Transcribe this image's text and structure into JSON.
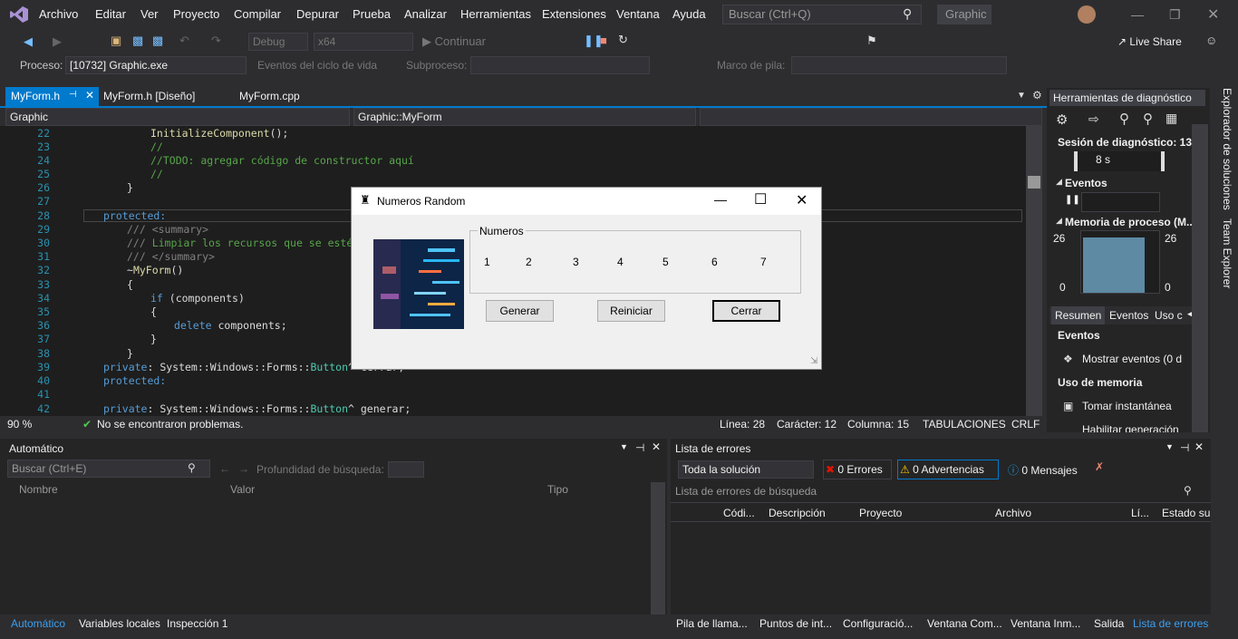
{
  "menu": [
    "Archivo",
    "Editar",
    "Ver",
    "Proyecto",
    "Compilar",
    "Depurar",
    "Prueba",
    "Analizar",
    "Herramientas",
    "Extensiones",
    "Ventana",
    "Ayuda"
  ],
  "search_placeholder": "Buscar (Ctrl+Q)",
  "app_name": "Graphic",
  "toolbar": {
    "config": "Debug",
    "platform": "x64",
    "continue": "Continuar",
    "live_share": "Live Share"
  },
  "procbar": {
    "process_label": "Proceso:",
    "process_value": "[10732] Graphic.exe",
    "lifecycle": "Eventos del ciclo de vida",
    "subprocess": "Subproceso:",
    "stack": "Marco de pila:"
  },
  "tabs": [
    {
      "label": "MyForm.h",
      "active": true
    },
    {
      "label": "MyForm.h [Diseño]",
      "active": false
    },
    {
      "label": "MyForm.cpp",
      "active": false
    }
  ],
  "nav": {
    "project": "Graphic",
    "scope": "Graphic::MyForm"
  },
  "editor": {
    "lines": [
      "22",
      "23",
      "24",
      "25",
      "26",
      "27",
      "28",
      "29",
      "30",
      "31",
      "32",
      "33",
      "34",
      "35",
      "36",
      "37",
      "38",
      "39",
      "40",
      "41",
      "42"
    ]
  },
  "editor_status": {
    "zoom": "90 %",
    "problems": "No se encontraron problemas.",
    "line": "Línea: 28",
    "char": "Carácter: 12",
    "col": "Columna: 15",
    "tabs": "TABULACIONES",
    "eol": "CRLF"
  },
  "diag": {
    "title": "Herramientas de diagnóstico",
    "session": "Sesión de diagnóstico: 13...",
    "time": "8 s",
    "events": "Eventos",
    "memory": "Memoria de proceso (M...",
    "mem_max_left": "26",
    "mem_max_right": "26",
    "mem_min_left": "0",
    "mem_min_right": "0",
    "tabs": [
      "Resumen",
      "Eventos",
      "Uso c"
    ],
    "events_header": "Eventos",
    "show_events": "Mostrar eventos (0 d",
    "mem_use": "Uso de memoria",
    "snapshot": "Tomar instantánea",
    "heap": "Habilitar generación"
  },
  "side_tabs": [
    "Explorador de soluciones",
    "Team Explorer"
  ],
  "auto_panel": {
    "title": "Automático",
    "search": "Buscar (Ctrl+E)",
    "depth": "Profundidad de búsqueda:",
    "cols": [
      "Nombre",
      "Valor",
      "Tipo"
    ]
  },
  "err_panel": {
    "title": "Lista de errores",
    "scope": "Toda la solución",
    "errors": "0 Errores",
    "warnings": "0 Advertencias",
    "messages": "0 Mensajes",
    "search": "Lista de errores de búsqueda",
    "cols": [
      "Códi...",
      "Descripción",
      "Proyecto",
      "Archivo",
      "Lí...",
      "Estado su"
    ]
  },
  "bottom_tabs_left": [
    "Automático",
    "Variables locales",
    "Inspección 1"
  ],
  "bottom_tabs_right": [
    "Pila de llama...",
    "Puntos de int...",
    "Configuració...",
    "Ventana Com...",
    "Ventana Inm...",
    "Salida",
    "Lista de errores"
  ],
  "dialog": {
    "title": "Numeros Random",
    "group": "Numeros",
    "numbers": [
      "1",
      "2",
      "3",
      "4",
      "5",
      "6",
      "7"
    ],
    "generate": "Generar",
    "reset": "Reiniciar",
    "close": "Cerrar"
  }
}
